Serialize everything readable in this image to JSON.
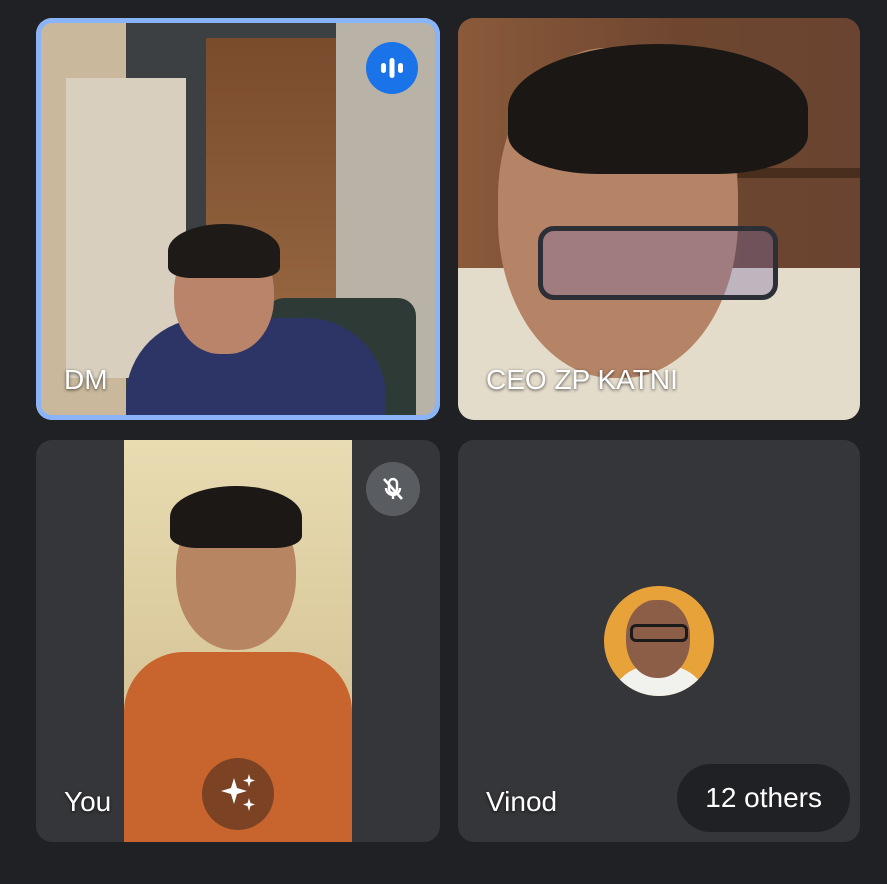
{
  "tiles": {
    "dm": {
      "name": "DM",
      "speaking": true,
      "icon": "audio-bars-icon"
    },
    "ceo": {
      "name": "CEO ZP KATNI"
    },
    "you": {
      "name": "You",
      "muted": true,
      "mic_icon": "mic-off-icon",
      "effects_icon": "sparkles-icon"
    },
    "others": {
      "name": "Vinod",
      "count_label": "12 others",
      "avatar_icon": "profile-avatar"
    }
  },
  "colors": {
    "background": "#202124",
    "speaking_border": "#8ab4f8",
    "speaking_badge": "#1a73e8",
    "pill_background": "#202124"
  }
}
